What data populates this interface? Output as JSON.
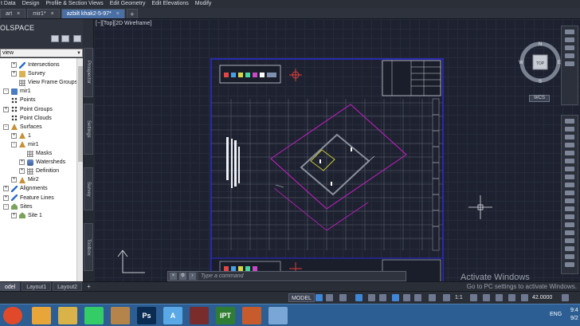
{
  "menu": {
    "items": [
      "t Data",
      "Design",
      "Profile & Section Views",
      "Edit Geometry",
      "Edit Elevations",
      "Modify"
    ]
  },
  "tabs": [
    {
      "label": "art",
      "active": false
    },
    {
      "label": "mir1*",
      "active": false
    },
    {
      "label": "azbilt khak2-5-97*",
      "active": true
    }
  ],
  "toolspace": {
    "title": "OLSPACE",
    "view_select": "view",
    "side_tabs": [
      "Prospector",
      "Settings",
      "Survey",
      "Toolbox"
    ],
    "tree": [
      {
        "label": "Intersections",
        "depth": 1,
        "toggle": "+",
        "icon": "intersection-icon"
      },
      {
        "label": "Survey",
        "depth": 1,
        "toggle": "+",
        "icon": "survey-icon"
      },
      {
        "label": "View Frame Groups",
        "depth": 1,
        "toggle": "",
        "icon": "view-frame-icon"
      },
      {
        "label": "mir1",
        "depth": 0,
        "toggle": "-",
        "icon": "drawing-icon"
      },
      {
        "label": "Points",
        "depth": 0,
        "toggle": "",
        "icon": "points-icon"
      },
      {
        "label": "Point Groups",
        "depth": 0,
        "toggle": "+",
        "icon": "point-groups-icon"
      },
      {
        "label": "Point Clouds",
        "depth": 0,
        "toggle": "",
        "icon": "point-clouds-icon"
      },
      {
        "label": "Surfaces",
        "depth": 0,
        "toggle": "-",
        "icon": "surfaces-icon"
      },
      {
        "label": "1",
        "depth": 1,
        "toggle": "+",
        "icon": "surface-icon"
      },
      {
        "label": "mir1",
        "depth": 1,
        "toggle": "-",
        "icon": "surface-icon"
      },
      {
        "label": "Masks",
        "depth": 2,
        "toggle": "",
        "icon": "masks-icon"
      },
      {
        "label": "Watersheds",
        "depth": 2,
        "toggle": "+",
        "icon": "watersheds-icon"
      },
      {
        "label": "Definition",
        "depth": 2,
        "toggle": "+",
        "icon": "definition-icon"
      },
      {
        "label": "Mir2",
        "depth": 1,
        "toggle": "+",
        "icon": "surface-icon"
      },
      {
        "label": "Alignments",
        "depth": 0,
        "toggle": "+",
        "icon": "alignments-icon"
      },
      {
        "label": "Feature Lines",
        "depth": 0,
        "toggle": "+",
        "icon": "feature-lines-icon"
      },
      {
        "label": "Sites",
        "depth": 0,
        "toggle": "-",
        "icon": "sites-icon"
      },
      {
        "label": "Site 1",
        "depth": 1,
        "toggle": "+",
        "icon": "site-icon"
      }
    ]
  },
  "viewport": {
    "label": "[−][Top][2D Wireframe]",
    "viewcube": {
      "n": "N",
      "e": "E",
      "s": "S",
      "w": "W",
      "top": "TOP"
    },
    "wcs": "WCS",
    "watermark_title": "Activate Windows"
  },
  "command": {
    "placeholder": "Type a command"
  },
  "layout_tabs": [
    {
      "label": "odel",
      "active": true
    },
    {
      "label": "Layout1",
      "active": false
    },
    {
      "label": "Layout2",
      "active": false
    }
  ],
  "watermark_sub": "Go to PC settings to activate Windows.",
  "status": {
    "model": "MODEL",
    "scale": "1:1",
    "coord": "42.0000"
  },
  "taskbar": {
    "apps": [
      {
        "name": "file-explorer-icon",
        "glyph": "",
        "color": "#e8a53a"
      },
      {
        "name": "paint-icon",
        "glyph": "",
        "color": "#d9b34a"
      },
      {
        "name": "chrome-icon",
        "glyph": "",
        "color": "#3c6"
      },
      {
        "name": "map-app-icon",
        "glyph": "",
        "color": "#b5844b"
      },
      {
        "name": "photoshop-icon",
        "glyph": "Ps",
        "color": "#0a2c52"
      },
      {
        "name": "autocad-icon",
        "glyph": "A",
        "color": "#5aa9e6"
      },
      {
        "name": "civil3d-icon",
        "glyph": "",
        "color": "#7a2b2b"
      },
      {
        "name": "ipt-icon",
        "glyph": "IPT",
        "color": "#2f7d32"
      },
      {
        "name": "powerpoint-icon",
        "glyph": "",
        "color": "#c75b2b"
      },
      {
        "name": "window-app-icon",
        "glyph": "",
        "color": "#7aa6d6"
      }
    ],
    "lang": "ENG",
    "time": "9:4",
    "date": "9/2"
  },
  "colors": {
    "canvas": "#1e2230",
    "sheet_border": "#2626c8",
    "magenta": "#c81ec8",
    "accent_tab": "#4a6fa5",
    "taskbar": "#2c5e93"
  }
}
